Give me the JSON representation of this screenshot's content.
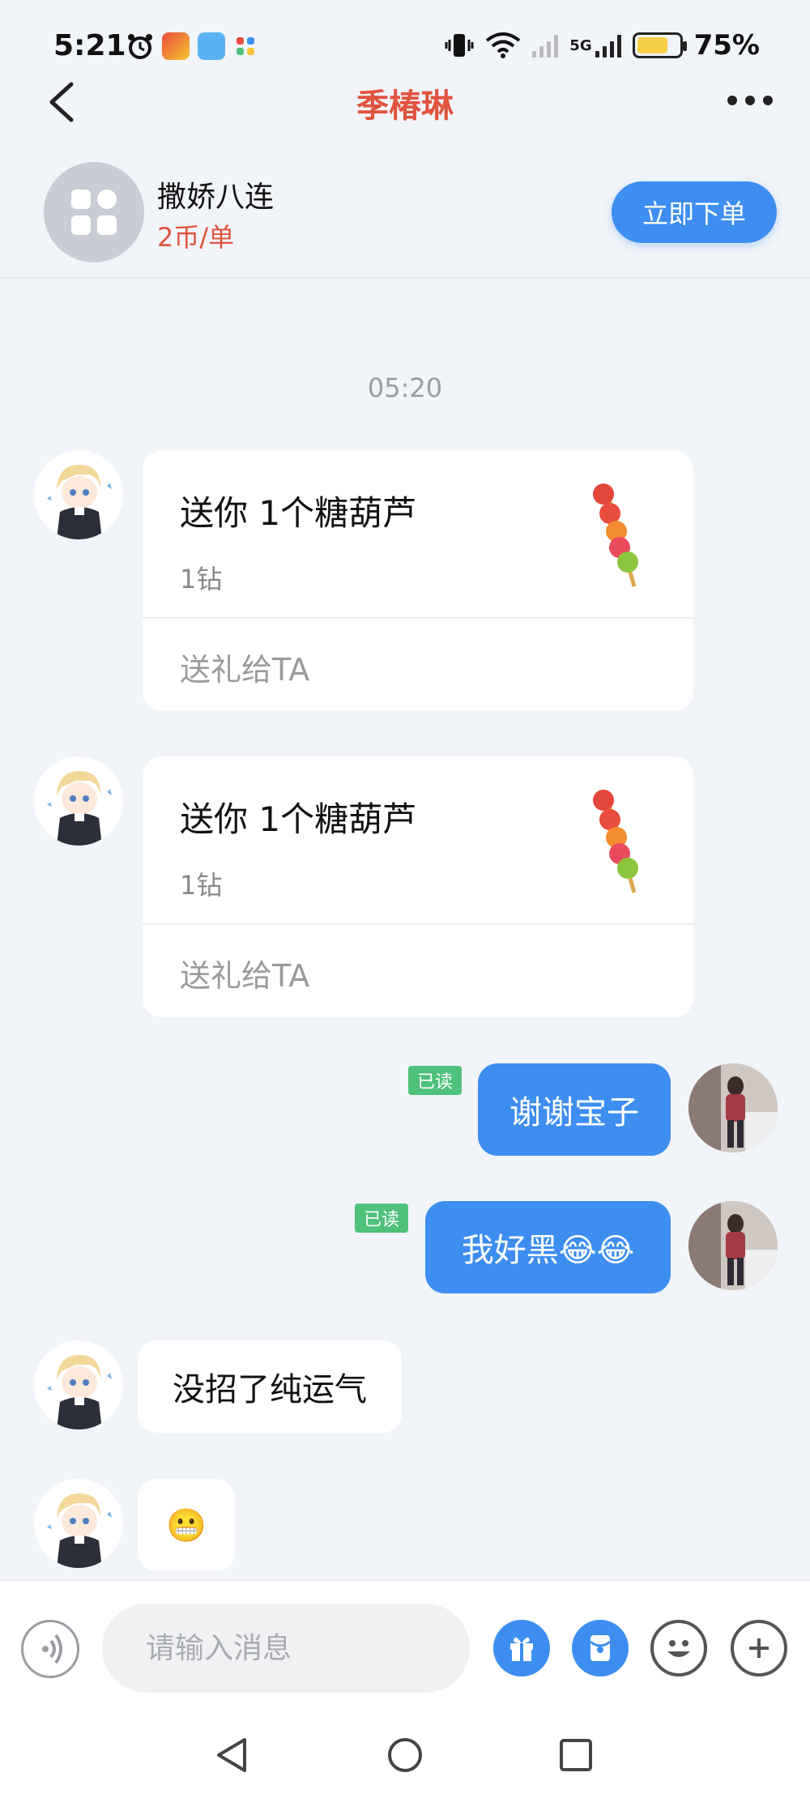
{
  "status_bar": {
    "time": "5:21",
    "network": "5G",
    "battery_percent": "75%",
    "battery_level": 0.75
  },
  "header": {
    "title": "季椿琳"
  },
  "product": {
    "name": "撒娇八连",
    "price": "2币/单",
    "order_button": "立即下单"
  },
  "chat": {
    "timestamp": "05:20",
    "gift_cards": [
      {
        "title": "送你 1个糖葫芦",
        "amount": "1钻",
        "action": "送礼给TA"
      },
      {
        "title": "送你 1个糖葫芦",
        "amount": "1钻",
        "action": "送礼给TA"
      }
    ],
    "messages": [
      {
        "side": "right",
        "text": "谢谢宝子",
        "read": "已读"
      },
      {
        "side": "right",
        "text": "我好黑😂😂",
        "read": "已读"
      },
      {
        "side": "left",
        "text": "没招了纯运气"
      },
      {
        "side": "left",
        "text": "😬"
      }
    ]
  },
  "input": {
    "placeholder": "请输入消息"
  },
  "colors": {
    "accent_blue": "#3d8ef0",
    "title_red": "#e0533d",
    "read_green": "#4fc17a"
  }
}
